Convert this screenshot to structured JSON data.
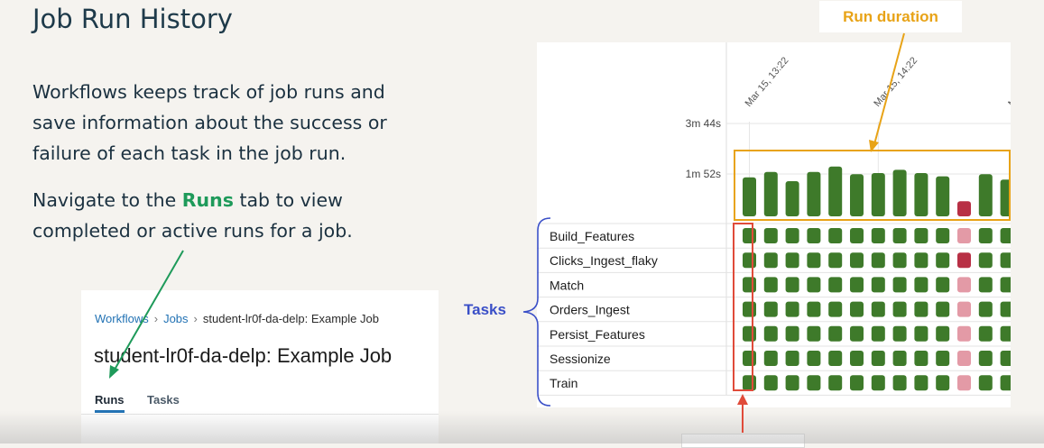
{
  "slide": {
    "title": "Job Run History",
    "paragraph1": "Workflows keeps track of job runs and save information about the success or failure of each task in the job run.",
    "paragraph2_prefix": "Navigate to the ",
    "paragraph2_highlight": "Runs",
    "paragraph2_suffix": " tab to view completed or active runs for a job."
  },
  "inset": {
    "breadcrumb": [
      "Workflows",
      "Jobs",
      "student-lr0f-da-delp: Example Job"
    ],
    "breadcrumb_separator": "›",
    "job_title": "student-lr0f-da-delp: Example Job",
    "tabs": [
      "Runs",
      "Tasks"
    ],
    "active_tab": "Runs"
  },
  "annotations": {
    "run_duration": "Run duration",
    "tasks": "Tasks"
  },
  "run_chart": {
    "time_labels": [
      "Mar 15, 13:22",
      "Mar 15, 14:22",
      "Ma"
    ],
    "duration_ticks": [
      "3m 44s",
      "1m 52s"
    ],
    "run_durations": [
      0.72,
      0.82,
      0.65,
      0.82,
      0.92,
      0.78,
      0.8,
      0.86,
      0.8,
      0.74,
      0.28,
      0.78,
      0.68
    ],
    "run_status": [
      "success",
      "success",
      "success",
      "success",
      "success",
      "success",
      "success",
      "success",
      "success",
      "success",
      "failed",
      "success",
      "success"
    ],
    "tasks": [
      {
        "name": "Build_Features",
        "status": [
          "success",
          "success",
          "success",
          "success",
          "success",
          "success",
          "success",
          "success",
          "success",
          "success",
          "skipped",
          "success",
          "success"
        ]
      },
      {
        "name": "Clicks_Ingest_flaky",
        "status": [
          "success",
          "success",
          "success",
          "success",
          "success",
          "success",
          "success",
          "success",
          "success",
          "success",
          "failed",
          "success",
          "success"
        ]
      },
      {
        "name": "Match",
        "status": [
          "success",
          "success",
          "success",
          "success",
          "success",
          "success",
          "success",
          "success",
          "success",
          "success",
          "skipped",
          "success",
          "success"
        ]
      },
      {
        "name": "Orders_Ingest",
        "status": [
          "success",
          "success",
          "success",
          "success",
          "success",
          "success",
          "success",
          "success",
          "success",
          "success",
          "skipped",
          "success",
          "success"
        ]
      },
      {
        "name": "Persist_Features",
        "status": [
          "success",
          "success",
          "success",
          "success",
          "success",
          "success",
          "success",
          "success",
          "success",
          "success",
          "skipped",
          "success",
          "success"
        ]
      },
      {
        "name": "Sessionize",
        "status": [
          "success",
          "success",
          "success",
          "success",
          "success",
          "success",
          "success",
          "success",
          "success",
          "success",
          "skipped",
          "success",
          "success"
        ]
      },
      {
        "name": "Train",
        "status": [
          "success",
          "success",
          "success",
          "success",
          "success",
          "success",
          "success",
          "success",
          "success",
          "success",
          "skipped",
          "success",
          "success"
        ]
      }
    ],
    "colors": {
      "success": "#3e7a2a",
      "failed": "#b83045",
      "skipped": "#e39aa6",
      "duration_highlight": "#e8a317",
      "column_highlight": "#e04b3a",
      "tasks_bracket": "#3a4fc7",
      "arrow_green": "#1e9a5a"
    }
  }
}
